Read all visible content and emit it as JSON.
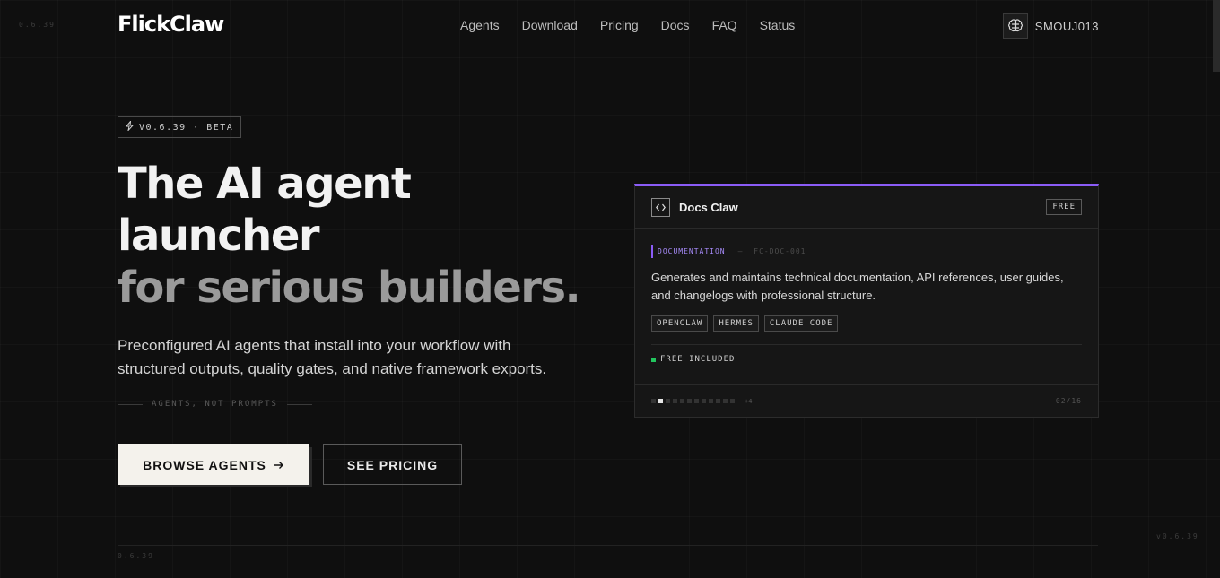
{
  "version_top_left": "0.6.39",
  "version_bottom_left": "0.6.39",
  "version_bottom_right": "v0.6.39",
  "header": {
    "logo": "FlickClaw",
    "nav": [
      "Agents",
      "Download",
      "Pricing",
      "Docs",
      "FAQ",
      "Status"
    ],
    "user": {
      "name": "SMOUJ013",
      "avatar_icon": "brain-icon"
    }
  },
  "hero": {
    "badge": "V0.6.39 · BETA",
    "badge_icon": "bolt-icon",
    "headline_line1": "The AI agent",
    "headline_line2": "launcher",
    "headline_line3": "for serious builders.",
    "subtext": "Preconfigured AI agents that install into your workflow with structured outputs, quality gates, and native framework exports.",
    "tagline": "AGENTS, NOT PROMPTS",
    "primary_button": "BROWSE AGENTS",
    "primary_button_icon": "arrow-right-icon",
    "secondary_button": "SEE PRICING"
  },
  "card": {
    "icon": "code-icon",
    "title": "Docs Claw",
    "price_badge": "FREE",
    "category": "DOCUMENTATION",
    "separator": "—",
    "id": "FC-DOC-001",
    "description": "Generates and maintains technical documentation, API references, user guides, and changelogs with professional structure.",
    "tags": [
      "OPENCLAW",
      "HERMES",
      "CLAUDE CODE"
    ],
    "included": "FREE INCLUDED",
    "pager_more": "+4",
    "pager_counter": "02/16",
    "pager_total_dots": 12,
    "pager_active_index": 1
  },
  "colors": {
    "accent": "#8b5cf6",
    "accent_text": "#a78bfa",
    "status_green": "#22c55e",
    "background": "#0f0f0f"
  }
}
